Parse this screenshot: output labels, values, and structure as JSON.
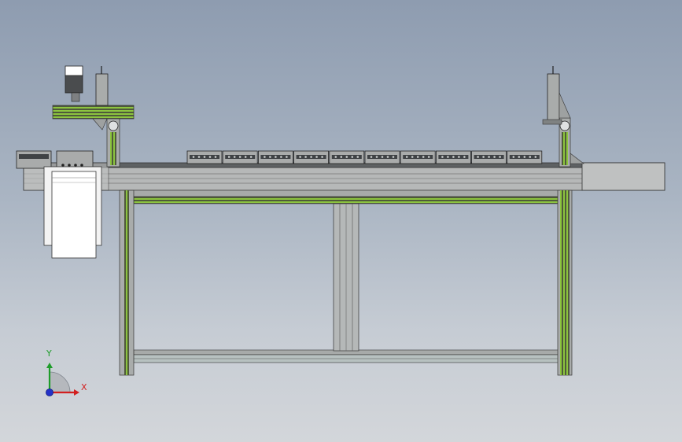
{
  "view": {
    "background_top": "#8e9cb0",
    "background_bottom": "#d3d6da"
  },
  "model": {
    "frame_color": "#a9acab",
    "frame_stripe_color": "#6fa53a",
    "carrier_count_on_line": 10,
    "carrier_count_left": 2,
    "uprights": 3,
    "sensor_posts": 2
  },
  "triad": {
    "x_label": "X",
    "y_label": "Y",
    "x_color": "#d21f1f",
    "y_color": "#1e9c2a",
    "z_color": "#2432c8"
  }
}
